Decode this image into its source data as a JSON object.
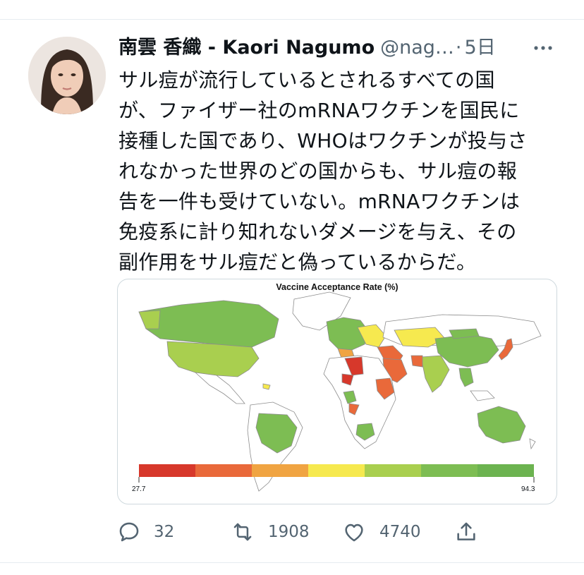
{
  "tweet": {
    "author_name": "南雲 香織 - Kaori Nagumo",
    "handle": "@nag…",
    "separator": "·",
    "time": "5日",
    "text": "サル痘が流行しているとされるすべての国\nが、ファイザー社のmRNAワクチンを国民に\n接種した国であり、WHOはワクチンが投与さ\nれなかった世界のどの国からも、サル痘の報\n告を一件も受けていない。mRNAワクチンは\n免疫系に計り知れないダメージを与え、その\n副作用をサル痘だと偽っているからだ。"
  },
  "map_image": {
    "title": "Vaccine Acceptance Rate (%)",
    "legend_min": "27.7",
    "legend_max": "94.3",
    "legend_colors": [
      "#d7382b",
      "#e9693a",
      "#f0a442",
      "#f6e94f",
      "#a9cf4f",
      "#7dbd53",
      "#6cb350"
    ]
  },
  "actions": {
    "replies": "32",
    "retweets": "1908",
    "likes": "4740"
  },
  "icons": {
    "more": "more-dots-icon",
    "reply": "reply-bubble-icon",
    "retweet": "retweet-arrows-icon",
    "like": "heart-icon",
    "share": "share-upload-icon"
  },
  "colors": {
    "text_primary": "#0f1419",
    "text_secondary": "#536471",
    "border": "#cfd9de"
  }
}
